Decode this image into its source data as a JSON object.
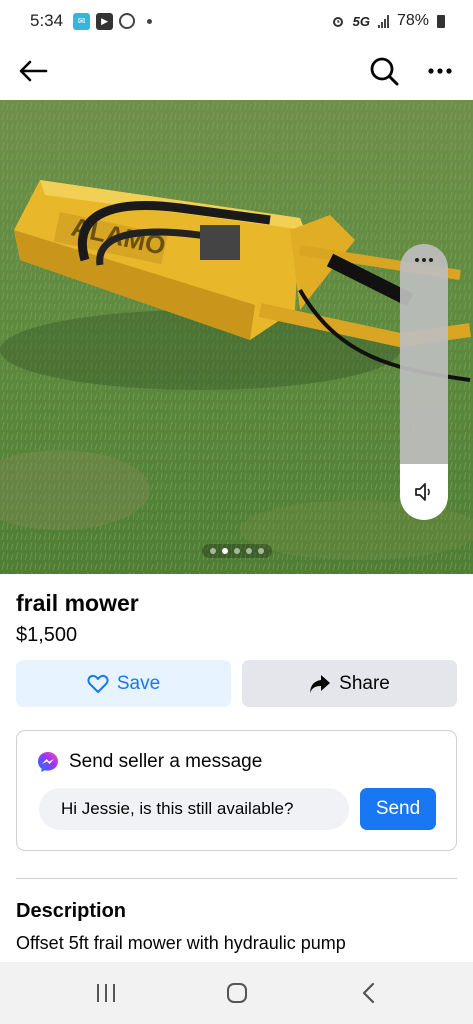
{
  "status_bar": {
    "time": "5:34",
    "network": "5G",
    "battery": "78%",
    "icons": [
      "messaging-icon",
      "youtube-icon",
      "hotspot-icon",
      "alarm-icon",
      "signal-icon",
      "battery-icon"
    ]
  },
  "top_bar": {
    "icons": [
      "back-arrow-icon",
      "search-icon",
      "more-icon"
    ]
  },
  "photo": {
    "description_icons": [
      "volume-icon"
    ],
    "carousel": {
      "count": 5,
      "active_index": 1
    },
    "brand_text": "ALAMO"
  },
  "listing": {
    "title": "frail mower",
    "price": "$1,500"
  },
  "actions": {
    "save_label": "Save",
    "share_label": "Share"
  },
  "message": {
    "heading": "Send seller a message",
    "input_value": "Hi Jessie, is this still available?",
    "send_label": "Send"
  },
  "description": {
    "heading": "Description",
    "text": "Offset 5ft frail mower with hydraulic pump"
  },
  "colors": {
    "accent": "#1877f2",
    "save_bg": "#e7f3ff",
    "share_bg": "#e4e6eb",
    "mower_yellow": "#e8b82a"
  }
}
